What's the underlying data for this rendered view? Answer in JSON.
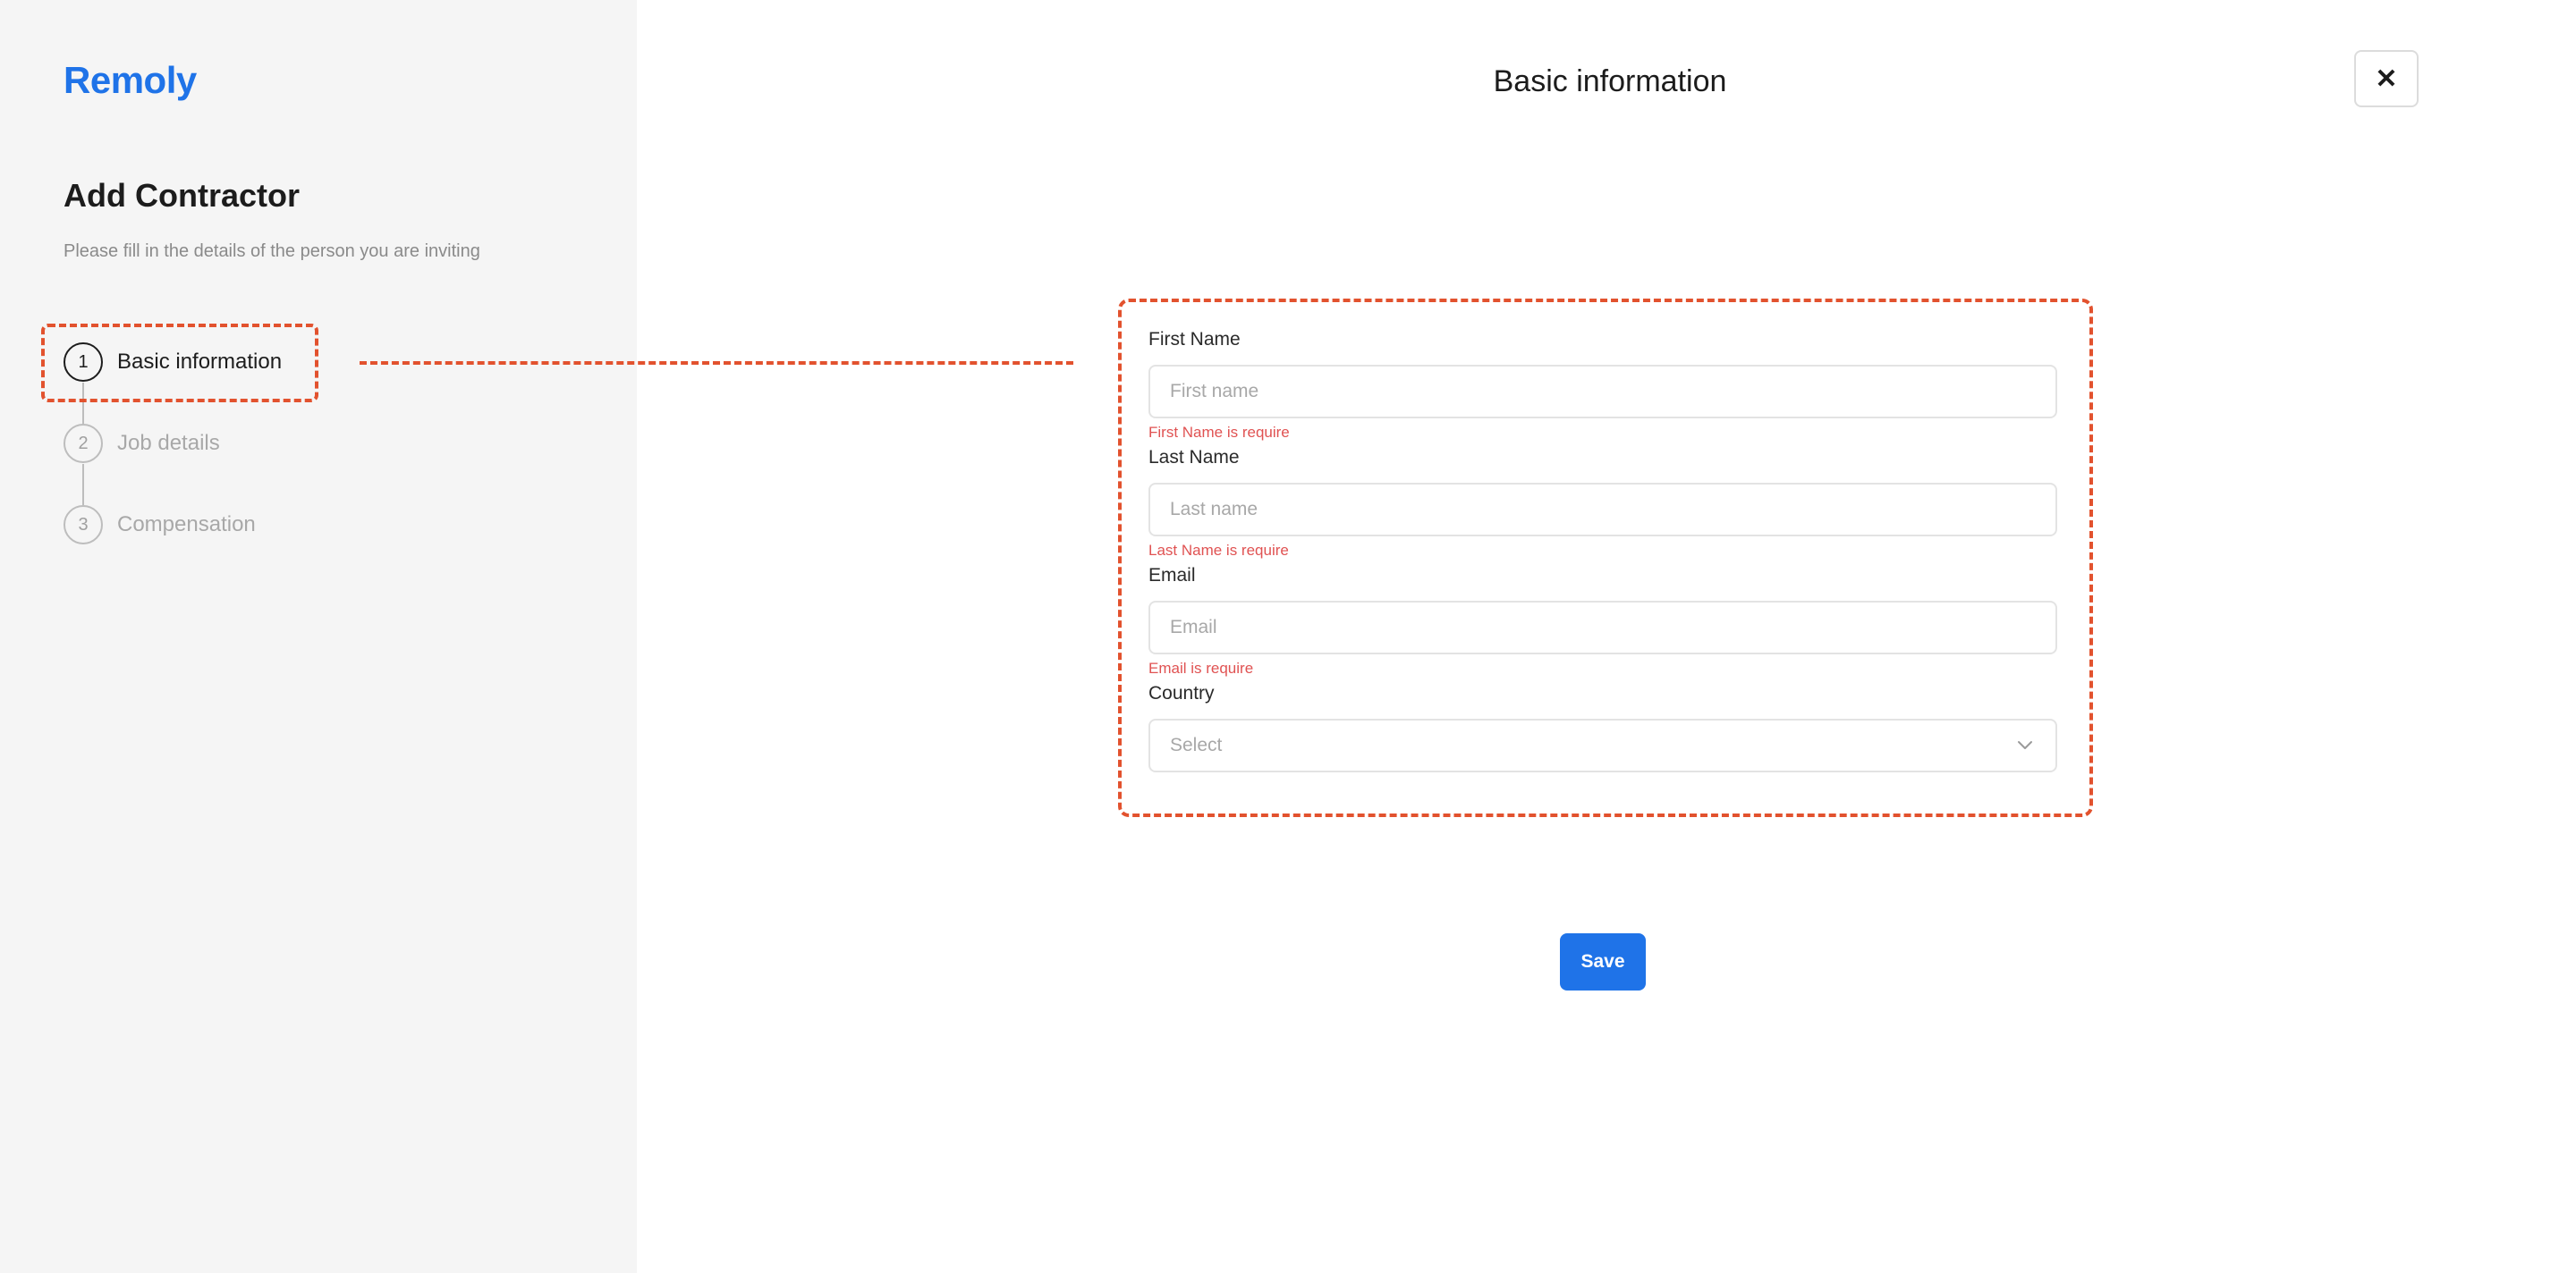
{
  "brand": "Remoly",
  "sidebar": {
    "title": "Add Contractor",
    "subtitle": "Please fill in the details of the person you are inviting",
    "steps": [
      {
        "number": "1",
        "label": "Basic information"
      },
      {
        "number": "2",
        "label": "Job details"
      },
      {
        "number": "3",
        "label": "Compensation"
      }
    ]
  },
  "main": {
    "title": "Basic information",
    "close_label": "✕"
  },
  "form": {
    "first_name": {
      "label": "First Name",
      "placeholder": "First name",
      "error": "First Name is require"
    },
    "last_name": {
      "label": "Last Name",
      "placeholder": "Last name",
      "error": "Last Name is require"
    },
    "email": {
      "label": "Email",
      "placeholder": "Email",
      "error": "Email is require"
    },
    "country": {
      "label": "Country",
      "value": "Select"
    },
    "save_label": "Save"
  },
  "colors": {
    "brand": "#1f73e8",
    "error": "#e05252",
    "annotation": "#e2522e",
    "sidebar_bg": "#f5f5f5"
  }
}
